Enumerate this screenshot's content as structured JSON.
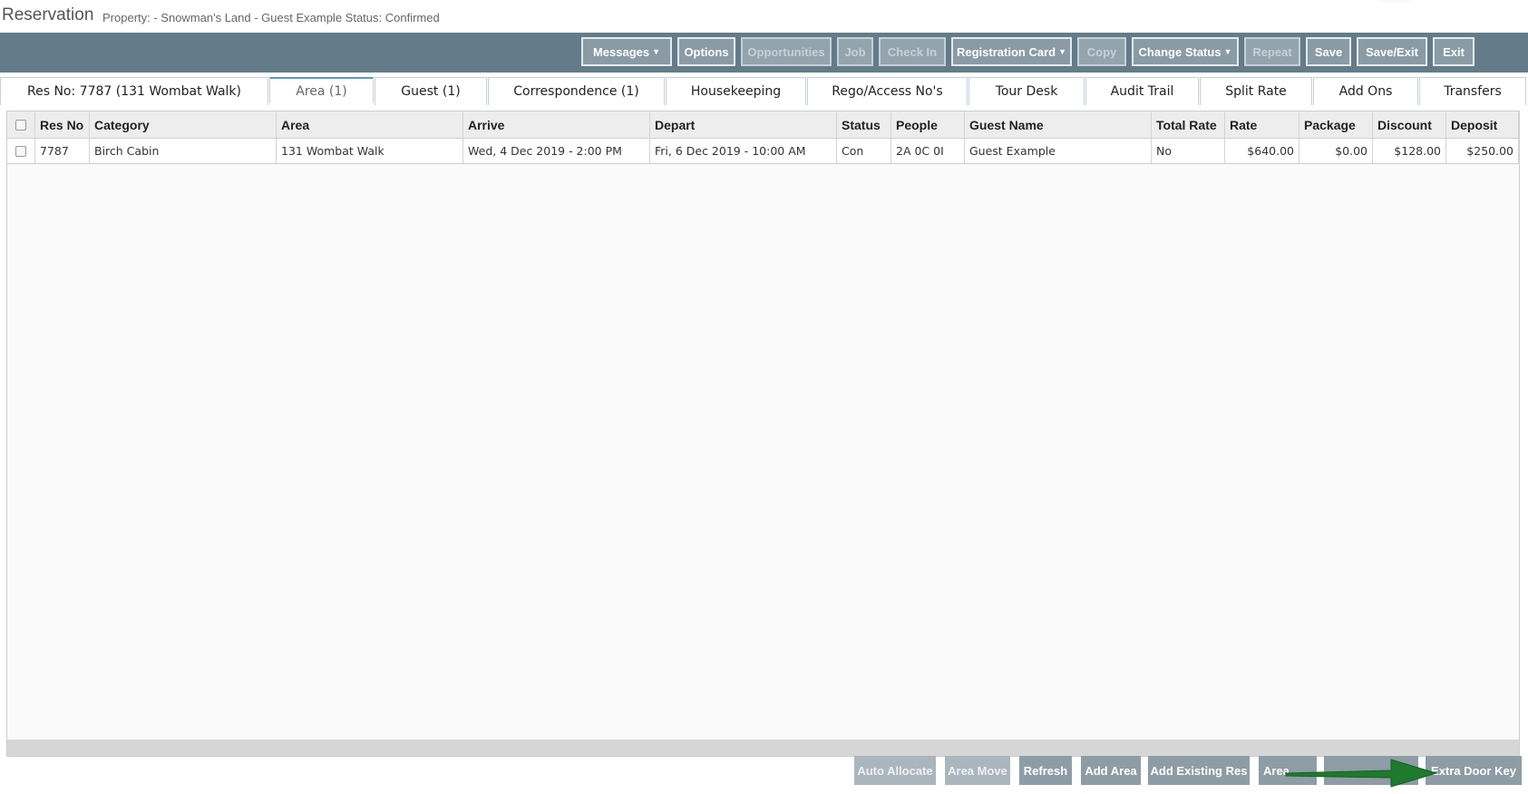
{
  "header": {
    "title": "Reservation",
    "property_line": "Property: - Snowman's Land -  Guest Example    Status: Confirmed"
  },
  "toolbar": {
    "messages": "Messages",
    "options": "Options",
    "opportunities": "Opportunities",
    "job": "Job",
    "check_in": "Check In",
    "registration_card": "Registration Card",
    "copy": "Copy",
    "change_status": "Change Status",
    "repeat": "Repeat",
    "save": "Save",
    "save_exit": "Save/Exit",
    "exit": "Exit"
  },
  "tabs": [
    {
      "label": "Res No: 7787 (131 Wombat Walk)"
    },
    {
      "label": "Area (1)"
    },
    {
      "label": "Guest (1)"
    },
    {
      "label": "Correspondence (1)"
    },
    {
      "label": "Housekeeping"
    },
    {
      "label": "Rego/Access No's"
    },
    {
      "label": "Tour Desk"
    },
    {
      "label": "Audit Trail"
    },
    {
      "label": "Split Rate"
    },
    {
      "label": "Add Ons"
    },
    {
      "label": "Transfers"
    }
  ],
  "grid": {
    "columns": [
      "Res No",
      "Category",
      "Area",
      "Arrive",
      "Depart",
      "Status",
      "People",
      "Guest Name",
      "Total Rate",
      "Rate",
      "Package",
      "Discount",
      "Deposit"
    ],
    "rows": [
      [
        "7787",
        "Birch Cabin",
        "131 Wombat Walk",
        "Wed, 4 Dec 2019 - 2:00 PM",
        "Fri, 6 Dec 2019 - 10:00 AM",
        "Con",
        "2A 0C 0I",
        "Guest Example",
        "No",
        "$640.00",
        "$0.00",
        "$128.00",
        "$250.00"
      ]
    ]
  },
  "bottom": {
    "auto_allocate": "Auto Allocate",
    "area_move": "Area Move",
    "refresh": "Refresh",
    "add_area": "Add Area",
    "add_existing_res": "Add Existing Res",
    "area_partial": "Area",
    "extra_door_key": "Extra Door Key"
  },
  "colors": {
    "toolbar_bg": "#647c89",
    "arrow": "#1e7a2c"
  }
}
